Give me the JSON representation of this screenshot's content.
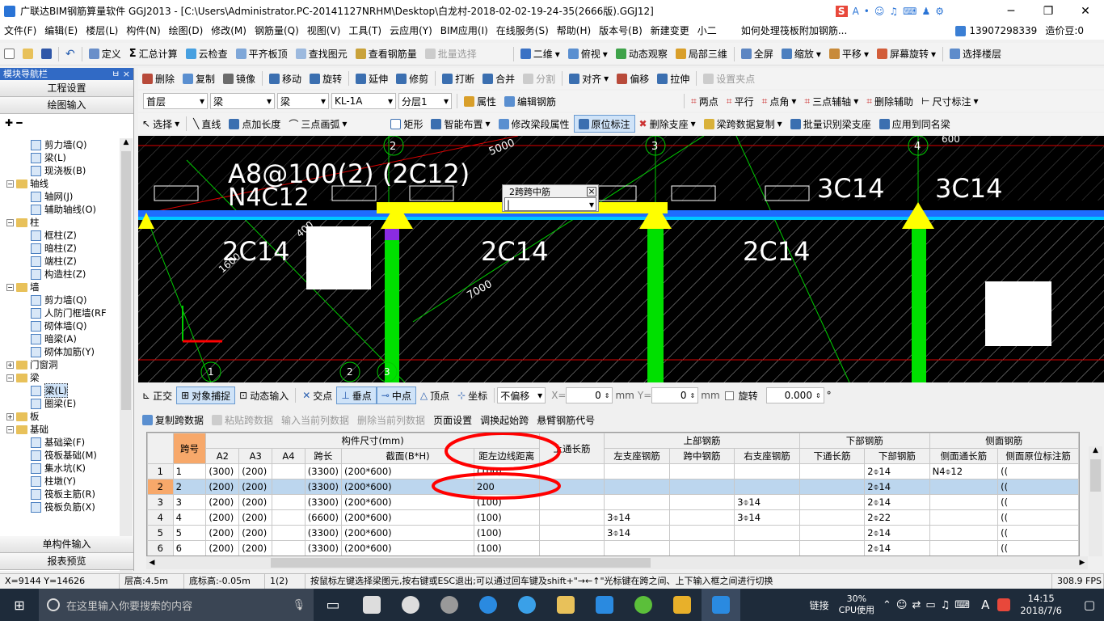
{
  "titlebar": {
    "title": "广联达BIM钢筋算量软件 GGJ2013 - [C:\\Users\\Administrator.PC-20141127NRHM\\Desktop\\白龙村-2018-02-02-19-24-35(2666版).GGJ12]",
    "minimize": "─",
    "maximize": "❐",
    "close": "✕"
  },
  "menubar": {
    "items": [
      "文件(F)",
      "编辑(E)",
      "楼层(L)",
      "构件(N)",
      "绘图(D)",
      "修改(M)",
      "钢筋量(Q)",
      "视图(V)",
      "工具(T)",
      "云应用(Y)",
      "BIM应用(I)",
      "在线服务(S)",
      "帮助(H)",
      "版本号(B)"
    ],
    "new_change": "新建变更",
    "xiaoguang": "小二",
    "question": "如何处理筏板附加钢筋...",
    "phone": "13907298339",
    "zaojiadou": "造价豆:0"
  },
  "toolbar1": {
    "items": [
      "定义",
      "汇总计算",
      "云检查",
      "平齐板顶",
      "查找图元",
      "查看钢筋量",
      "批量选择"
    ],
    "right": [
      "二维",
      "俯视",
      "动态观察",
      "局部三维",
      "全屏",
      "缩放",
      "平移",
      "屏幕旋转",
      "选择楼层"
    ]
  },
  "navpane": {
    "title": "模块导航栏",
    "pin": "ㅂ",
    "close": "×",
    "btn_project": "工程设置",
    "btn_draw": "绘图输入",
    "btn_single": "单构件输入",
    "btn_report": "报表预览",
    "tree": [
      {
        "lvl": 2,
        "label": "剪力墙(Q)"
      },
      {
        "lvl": 2,
        "label": "梁(L)"
      },
      {
        "lvl": 2,
        "label": "现浇板(B)"
      },
      {
        "lvl": 1,
        "label": "轴线",
        "toggle": "−"
      },
      {
        "lvl": 2,
        "label": "轴网(J)"
      },
      {
        "lvl": 2,
        "label": "辅助轴线(O)"
      },
      {
        "lvl": 1,
        "label": "柱",
        "toggle": "−"
      },
      {
        "lvl": 2,
        "label": "框柱(Z)"
      },
      {
        "lvl": 2,
        "label": "暗柱(Z)"
      },
      {
        "lvl": 2,
        "label": "端柱(Z)"
      },
      {
        "lvl": 2,
        "label": "构造柱(Z)"
      },
      {
        "lvl": 1,
        "label": "墙",
        "toggle": "−"
      },
      {
        "lvl": 2,
        "label": "剪力墙(Q)"
      },
      {
        "lvl": 2,
        "label": "人防门框墙(RF"
      },
      {
        "lvl": 2,
        "label": "砌体墙(Q)"
      },
      {
        "lvl": 2,
        "label": "暗梁(A)"
      },
      {
        "lvl": 2,
        "label": "砌体加筋(Y)"
      },
      {
        "lvl": 1,
        "label": "门窗洞",
        "toggle": "+"
      },
      {
        "lvl": 1,
        "label": "梁",
        "toggle": "−"
      },
      {
        "lvl": 2,
        "label": "梁(L)",
        "sel": true
      },
      {
        "lvl": 2,
        "label": "圈梁(E)"
      },
      {
        "lvl": 1,
        "label": "板",
        "toggle": "+"
      },
      {
        "lvl": 1,
        "label": "基础",
        "toggle": "−"
      },
      {
        "lvl": 2,
        "label": "基础梁(F)"
      },
      {
        "lvl": 2,
        "label": "筏板基础(M)"
      },
      {
        "lvl": 2,
        "label": "集水坑(K)"
      },
      {
        "lvl": 2,
        "label": "柱墩(Y)"
      },
      {
        "lvl": 2,
        "label": "筏板主筋(R)"
      },
      {
        "lvl": 2,
        "label": "筏板负筋(X)"
      }
    ]
  },
  "toolbar2": {
    "items": [
      "删除",
      "复制",
      "镜像",
      "移动",
      "旋转",
      "延伸",
      "修剪",
      "打断",
      "合并",
      "分割",
      "对齐",
      "偏移",
      "拉伸",
      "设置夹点"
    ]
  },
  "toolbar3": {
    "floor": "首层",
    "type1": "梁",
    "type2": "梁",
    "name": "KL-1A",
    "layer": "分层1",
    "attr": "属性",
    "edit": "编辑钢筋",
    "right": [
      "两点",
      "平行",
      "点角",
      "三点辅轴",
      "删除辅助",
      "尺寸标注"
    ]
  },
  "toolbar4": {
    "items": [
      "选择",
      "直线",
      "点加长度",
      "三点画弧",
      "矩形",
      "智能布置",
      "修改梁段属性",
      "原位标注",
      "删除支座",
      "梁跨数据复制",
      "批量识别梁支座",
      "应用到同名梁"
    ]
  },
  "canvas": {
    "label1": "A8@100(2)  (2C12)",
    "label2": "N4C12",
    "label3": "3C14",
    "label4": "3C14",
    "bot1": "2C14",
    "bot2": "2C14",
    "bot3": "2C14",
    "axis2": "2",
    "axis3": "3",
    "axis4": "4",
    "dim5000": "5000",
    "dim7000": "7000",
    "dim400": "400",
    "dim1600": "1600",
    "dim600": "600",
    "axisB1": "1",
    "axisB2": "2",
    "axisB3": "3",
    "popup_title": "2跨跨中筋",
    "popup_close": "×",
    "popup_value": "|"
  },
  "snapbar": {
    "items": [
      "正交",
      "对象捕捉",
      "动态输入",
      "交点",
      "垂点",
      "中点",
      "顶点",
      "坐标"
    ],
    "offset": "不偏移",
    "x_label": "X=",
    "x_val": "0",
    "mm1": "mm",
    "y_label": "Y=",
    "y_val": "0",
    "mm2": "mm",
    "rotate": "旋转",
    "rot_val": "0.000",
    "deg": "°"
  },
  "gridtb": {
    "items": [
      "复制跨数据",
      "粘贴跨数据",
      "输入当前列数据",
      "删除当前列数据",
      "页面设置",
      "调换起始跨",
      "悬臂钢筋代号"
    ]
  },
  "grid": {
    "h_span": "跨号",
    "h_size": "构件尺寸(mm)",
    "h_top": "上部钢筋",
    "h_bottom": "下部钢筋",
    "h_side": "侧面钢筋",
    "h_cols": [
      "A2",
      "A3",
      "A4",
      "跨长",
      "截面(B*H)",
      "距左边线距离",
      "上通长筋",
      "左支座钢筋",
      "跨中钢筋",
      "右支座钢筋",
      "下通长筋",
      "下部钢筋",
      "侧面通长筋",
      "侧面原位标注筋"
    ],
    "rows": [
      [
        "1",
        "1",
        "(300)",
        "(200)",
        "",
        "(3300)",
        "(200*600)",
        "(100)",
        "",
        "",
        "",
        "",
        "",
        "2⌽14",
        "N4⌽12",
        "(("
      ],
      [
        "2",
        "2",
        "(200)",
        "(200)",
        "",
        "(3300)",
        "(200*600)",
        "200",
        "",
        "",
        "",
        "",
        "",
        "2⌽14",
        "",
        "(("
      ],
      [
        "3",
        "3",
        "(200)",
        "(200)",
        "",
        "(3300)",
        "(200*600)",
        "(100)",
        "",
        "",
        "",
        "3⌽14",
        "",
        "2⌽14",
        "",
        "(("
      ],
      [
        "4",
        "4",
        "(200)",
        "(200)",
        "",
        "(6600)",
        "(200*600)",
        "(100)",
        "",
        "3⌽14",
        "",
        "3⌽14",
        "",
        "2⌽22",
        "",
        "(("
      ],
      [
        "5",
        "5",
        "(200)",
        "(200)",
        "",
        "(3300)",
        "(200*600)",
        "(100)",
        "",
        "3⌽14",
        "",
        "",
        "",
        "2⌽14",
        "",
        "(("
      ],
      [
        "6",
        "6",
        "(200)",
        "(200)",
        "",
        "(3300)",
        "(200*600)",
        "(100)",
        "",
        "",
        "",
        "",
        "",
        "2⌽14",
        "",
        "(("
      ]
    ]
  },
  "statusbar": {
    "coords": "X=9144 Y=14626",
    "floorh": "层高:4.5m",
    "base": "底标高:-0.05m",
    "sel": "1(2)",
    "hint": "按鼠标左键选择梁图元,按右键或ESC退出;可以通过回车键及shift+\"→←↑\"光标键在跨之间、上下输入框之间进行切换",
    "fps": "308.9 FPS"
  },
  "taskbar": {
    "search": "在这里输入你要搜索的内容",
    "link": "链接",
    "cpu": "30%",
    "cpu_label": "CPU使用",
    "time": "14:15",
    "date": "2018/7/6",
    "ime": "A"
  },
  "colors": {
    "accent": "#316ac5",
    "beam_blue": "#1e6cff",
    "support_yellow": "#ffff00",
    "column_green": "#00e000",
    "annotation_red": "#ff0000"
  }
}
